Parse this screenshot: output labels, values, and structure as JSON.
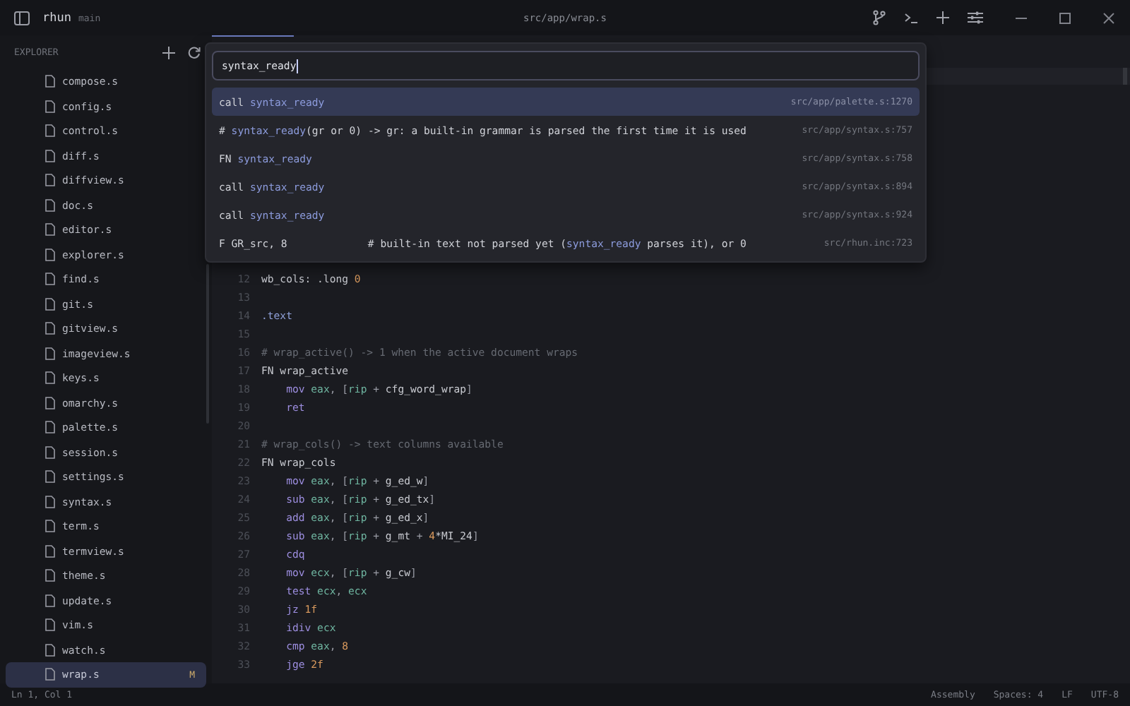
{
  "titlebar": {
    "app": "rhun",
    "branch": "main",
    "path": "src/app/wrap.s"
  },
  "explorer": {
    "title": "EXPLORER",
    "files": [
      {
        "name": "compose.s",
        "selected": false
      },
      {
        "name": "config.s",
        "selected": false
      },
      {
        "name": "control.s",
        "selected": false
      },
      {
        "name": "diff.s",
        "selected": false
      },
      {
        "name": "diffview.s",
        "selected": false
      },
      {
        "name": "doc.s",
        "selected": false
      },
      {
        "name": "editor.s",
        "selected": false
      },
      {
        "name": "explorer.s",
        "selected": false
      },
      {
        "name": "find.s",
        "selected": false
      },
      {
        "name": "git.s",
        "selected": false
      },
      {
        "name": "gitview.s",
        "selected": false
      },
      {
        "name": "imageview.s",
        "selected": false
      },
      {
        "name": "keys.s",
        "selected": false
      },
      {
        "name": "omarchy.s",
        "selected": false
      },
      {
        "name": "palette.s",
        "selected": false
      },
      {
        "name": "session.s",
        "selected": false
      },
      {
        "name": "settings.s",
        "selected": false
      },
      {
        "name": "syntax.s",
        "selected": false
      },
      {
        "name": "term.s",
        "selected": false
      },
      {
        "name": "termview.s",
        "selected": false
      },
      {
        "name": "theme.s",
        "selected": false
      },
      {
        "name": "update.s",
        "selected": false
      },
      {
        "name": "vim.s",
        "selected": false
      },
      {
        "name": "watch.s",
        "selected": false
      },
      {
        "name": "wrap.s",
        "selected": true,
        "badge": "M"
      }
    ]
  },
  "palette": {
    "query": "syntax_ready",
    "results": [
      {
        "selected": true,
        "text": "call **syntax_ready**",
        "location": "src/app/palette.s:1270"
      },
      {
        "selected": false,
        "text": "# **syntax_ready**(gr or 0) -> gr: a built-in grammar is parsed the first time it is used",
        "location": "src/app/syntax.s:757"
      },
      {
        "selected": false,
        "text": "FN **syntax_ready**",
        "location": "src/app/syntax.s:758"
      },
      {
        "selected": false,
        "text": "call **syntax_ready**",
        "location": "src/app/syntax.s:894"
      },
      {
        "selected": false,
        "text": "call **syntax_ready**",
        "location": "src/app/syntax.s:924"
      },
      {
        "selected": false,
        "text": "F GR_src, 8             # built-in text not parsed yet (**syntax_ready** parses it), or 0",
        "location": "src/rhun.inc:723"
      }
    ]
  },
  "editor": {
    "lines": [
      {
        "num": "12",
        "tokens": [
          {
            "t": "wb_cols: .long ",
            "kind": "text"
          },
          {
            "t": "0",
            "kind": "num"
          }
        ]
      },
      {
        "num": "13"
      },
      {
        "num": "14",
        "tokens": [
          {
            "t": ".text",
            "kind": "directive"
          }
        ]
      },
      {
        "num": "15"
      },
      {
        "num": "16",
        "tokens": [
          {
            "t": "# wrap_active() -> 1 when the active document wraps",
            "kind": "comment"
          }
        ]
      },
      {
        "num": "17",
        "tokens": [
          {
            "t": "FN wrap_active",
            "kind": "text"
          }
        ]
      },
      {
        "num": "18",
        "tokens": [
          {
            "t": "    mov",
            "kind": "kw"
          },
          {
            "t": " eax",
            "kind": "reg"
          },
          {
            "t": ", [",
            "kind": "punct"
          },
          {
            "t": "rip",
            "kind": "reg"
          },
          {
            "t": " + ",
            "kind": "punct"
          },
          {
            "t": "cfg_word_wrap",
            "kind": "text"
          },
          {
            "t": "]",
            "kind": "punct"
          }
        ]
      },
      {
        "num": "19",
        "tokens": [
          {
            "t": "    ret",
            "kind": "kw"
          }
        ]
      },
      {
        "num": "20"
      },
      {
        "num": "21",
        "tokens": [
          {
            "t": "# wrap_cols() -> text columns available",
            "kind": "comment"
          }
        ]
      },
      {
        "num": "22",
        "tokens": [
          {
            "t": "FN wrap_cols",
            "kind": "text"
          }
        ]
      },
      {
        "num": "23",
        "tokens": [
          {
            "t": "    mov",
            "kind": "kw"
          },
          {
            "t": " eax",
            "kind": "reg"
          },
          {
            "t": ", [",
            "kind": "punct"
          },
          {
            "t": "rip",
            "kind": "reg"
          },
          {
            "t": " + ",
            "kind": "punct"
          },
          {
            "t": "g_ed_w",
            "kind": "text"
          },
          {
            "t": "]",
            "kind": "punct"
          }
        ]
      },
      {
        "num": "24",
        "tokens": [
          {
            "t": "    sub",
            "kind": "kw"
          },
          {
            "t": " eax",
            "kind": "reg"
          },
          {
            "t": ", [",
            "kind": "punct"
          },
          {
            "t": "rip",
            "kind": "reg"
          },
          {
            "t": " + ",
            "kind": "punct"
          },
          {
            "t": "g_ed_tx",
            "kind": "text"
          },
          {
            "t": "]",
            "kind": "punct"
          }
        ]
      },
      {
        "num": "25",
        "tokens": [
          {
            "t": "    add",
            "kind": "kw"
          },
          {
            "t": " eax",
            "kind": "reg"
          },
          {
            "t": ", [",
            "kind": "punct"
          },
          {
            "t": "rip",
            "kind": "reg"
          },
          {
            "t": " + ",
            "kind": "punct"
          },
          {
            "t": "g_ed_x",
            "kind": "text"
          },
          {
            "t": "]",
            "kind": "punct"
          }
        ]
      },
      {
        "num": "26",
        "tokens": [
          {
            "t": "    sub",
            "kind": "kw"
          },
          {
            "t": " eax",
            "kind": "reg"
          },
          {
            "t": ", [",
            "kind": "punct"
          },
          {
            "t": "rip",
            "kind": "reg"
          },
          {
            "t": " + ",
            "kind": "punct"
          },
          {
            "t": "g_mt",
            "kind": "text"
          },
          {
            "t": " + ",
            "kind": "punct"
          },
          {
            "t": "4",
            "kind": "num"
          },
          {
            "t": "*MI_24",
            "kind": "text"
          },
          {
            "t": "]",
            "kind": "punct"
          }
        ]
      },
      {
        "num": "27",
        "tokens": [
          {
            "t": "    cdq",
            "kind": "kw"
          }
        ]
      },
      {
        "num": "28",
        "tokens": [
          {
            "t": "    mov",
            "kind": "kw"
          },
          {
            "t": " ecx",
            "kind": "reg"
          },
          {
            "t": ", [",
            "kind": "punct"
          },
          {
            "t": "rip",
            "kind": "reg"
          },
          {
            "t": " + ",
            "kind": "punct"
          },
          {
            "t": "g_cw",
            "kind": "text"
          },
          {
            "t": "]",
            "kind": "punct"
          }
        ]
      },
      {
        "num": "29",
        "tokens": [
          {
            "t": "    test",
            "kind": "kw"
          },
          {
            "t": " ecx",
            "kind": "reg"
          },
          {
            "t": ", ",
            "kind": "punct"
          },
          {
            "t": "ecx",
            "kind": "reg"
          }
        ]
      },
      {
        "num": "30",
        "tokens": [
          {
            "t": "    jz",
            "kind": "kw"
          },
          {
            "t": " 1f",
            "kind": "num"
          }
        ]
      },
      {
        "num": "31",
        "tokens": [
          {
            "t": "    idiv",
            "kind": "kw"
          },
          {
            "t": " ecx",
            "kind": "reg"
          }
        ]
      },
      {
        "num": "32",
        "tokens": [
          {
            "t": "    cmp",
            "kind": "kw"
          },
          {
            "t": " eax",
            "kind": "reg"
          },
          {
            "t": ", ",
            "kind": "punct"
          },
          {
            "t": "8",
            "kind": "num"
          }
        ]
      },
      {
        "num": "33",
        "tokens": [
          {
            "t": "    jge",
            "kind": "kw"
          },
          {
            "t": " 2f",
            "kind": "num"
          }
        ]
      }
    ]
  },
  "status_bar": {
    "position": "Ln 1, Col 1",
    "items": [
      "Assembly",
      "Spaces: 4",
      "LF",
      "UTF-8"
    ]
  }
}
